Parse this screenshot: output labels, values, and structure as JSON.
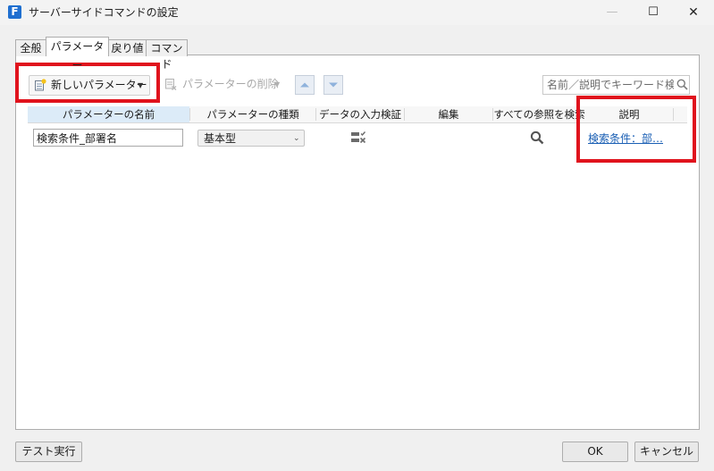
{
  "window": {
    "app_icon_letter": "F",
    "title": "サーバーサイドコマンドの設定",
    "minimize_glyph": "—",
    "maximize_glyph": "☐",
    "close_glyph": "✕"
  },
  "tabs": [
    {
      "label": "全般"
    },
    {
      "label": "パラメーター",
      "selected": true
    },
    {
      "label": "戻り値"
    },
    {
      "label": "コマンド"
    }
  ],
  "toolbar": {
    "new_param_label": "新しいパラメーター",
    "delete_param_label": "パラメーターの削除",
    "dropdown_caret": "▼",
    "search_placeholder": "名前／説明でキーワード検索",
    "new_param_icon": "add-document-icon",
    "delete_param_icon": "delete-document-icon",
    "move_up_icon": "arrow-up-icon",
    "move_down_icon": "arrow-down-icon"
  },
  "grid": {
    "columns": [
      "パラメーターの名前",
      "パラメーターの種類",
      "データの入力検証",
      "編集",
      "すべての参照を検索",
      "説明"
    ],
    "rows": [
      {
        "name": "検索条件_部署名",
        "type": "基本型",
        "description": "検索条件：部…"
      }
    ],
    "select_caret": "⌄"
  },
  "buttons": {
    "test_run": "テスト実行",
    "ok": "OK",
    "cancel": "キャンセル"
  },
  "colors": {
    "accent": "#1f6fd0",
    "highlight": "#e0131d",
    "link": "#1a5fb4",
    "selected_header": "#dcebf8"
  }
}
